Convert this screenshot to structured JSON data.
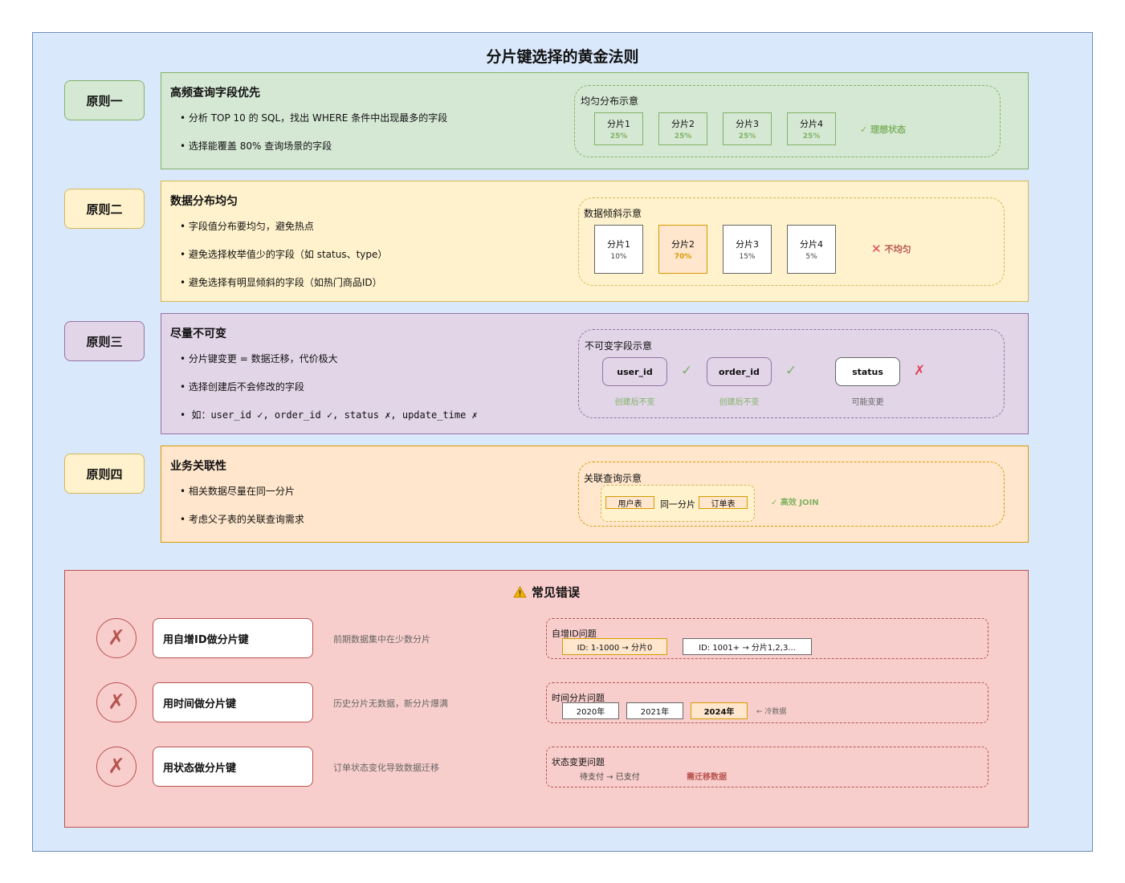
{
  "title": "分片键选择的黄金法则",
  "principles": [
    {
      "label": "原则一",
      "heading": "高频查询字段优先",
      "bullets": [
        "• 分析 TOP 10 的 SQL，找出 WHERE 条件中出现最多的字段",
        "• 选择能覆盖 80% 查询场景的字段"
      ],
      "demo_label": "均匀分布示意",
      "shards": [
        {
          "name": "分片1",
          "pct": "25%"
        },
        {
          "name": "分片2",
          "pct": "25%"
        },
        {
          "name": "分片3",
          "pct": "25%"
        },
        {
          "name": "分片4",
          "pct": "25%"
        }
      ],
      "status": "✓ 理想状态"
    },
    {
      "label": "原则二",
      "heading": "数据分布均匀",
      "bullets": [
        "• 字段值分布要均匀，避免热点",
        "• 避免选择枚举值少的字段（如 status、type）",
        "• 避免选择有明显倾斜的字段（如热门商品ID）"
      ],
      "demo_label": "数据倾斜示意",
      "shards": [
        {
          "name": "分片1",
          "pct": "10%"
        },
        {
          "name": "分片2",
          "pct": "70%"
        },
        {
          "name": "分片3",
          "pct": "15%"
        },
        {
          "name": "分片4",
          "pct": "5%"
        }
      ],
      "status": "不均匀"
    },
    {
      "label": "原则三",
      "heading": "尽量不可变",
      "bullets": [
        "• 分片键变更 = 数据迁移，代价极大",
        "• 选择创建后不会修改的字段",
        "• 如：user_id ✓, order_id ✓, status ✗, update_time ✗"
      ],
      "demo_label": "不可变字段示意",
      "fields": [
        {
          "name": "user_id",
          "mark": "✓",
          "note": "创建后不变"
        },
        {
          "name": "order_id",
          "mark": "✓",
          "note": "创建后不变"
        },
        {
          "name": "status",
          "mark": "✗",
          "note": "可能变更"
        }
      ]
    },
    {
      "label": "原则四",
      "heading": "业务关联性",
      "bullets": [
        "• 相关数据尽量在同一分片",
        "• 考虑父子表的关联查询需求"
      ],
      "demo_label": "关联查询示意",
      "table_a": "用户表",
      "same_shard": "同一分片",
      "table_b": "订单表",
      "status": "✓ 高效 JOIN"
    }
  ],
  "mistakes": {
    "heading": "常见错误",
    "items": [
      {
        "title": "用自增ID做分片键",
        "desc": "前期数据集中在少数分片",
        "demo_label": "自增ID问题",
        "boxes": [
          "ID: 1-1000 → 分片0",
          "ID: 1001+ → 分片1,2,3..."
        ]
      },
      {
        "title": "用时间做分片键",
        "desc": "历史分片无数据，新分片爆满",
        "demo_label": "时间分片问题",
        "boxes": [
          "2020年",
          "2021年",
          "2024年"
        ],
        "note": "← 冷数据"
      },
      {
        "title": "用状态做分片键",
        "desc": "订单状态变化导致数据迁移",
        "demo_label": "状态变更问题",
        "flow": "待支付 → 已支付",
        "note": "需迁移数据"
      }
    ]
  },
  "colors": {
    "blue_bg": "#dae8fc",
    "green_bg": "#d5e8d4",
    "yellow_bg": "#fff2cc",
    "purple_bg": "#e1d5e7",
    "orange_bg": "#ffe6cc",
    "red_bg": "#f8cecc"
  }
}
